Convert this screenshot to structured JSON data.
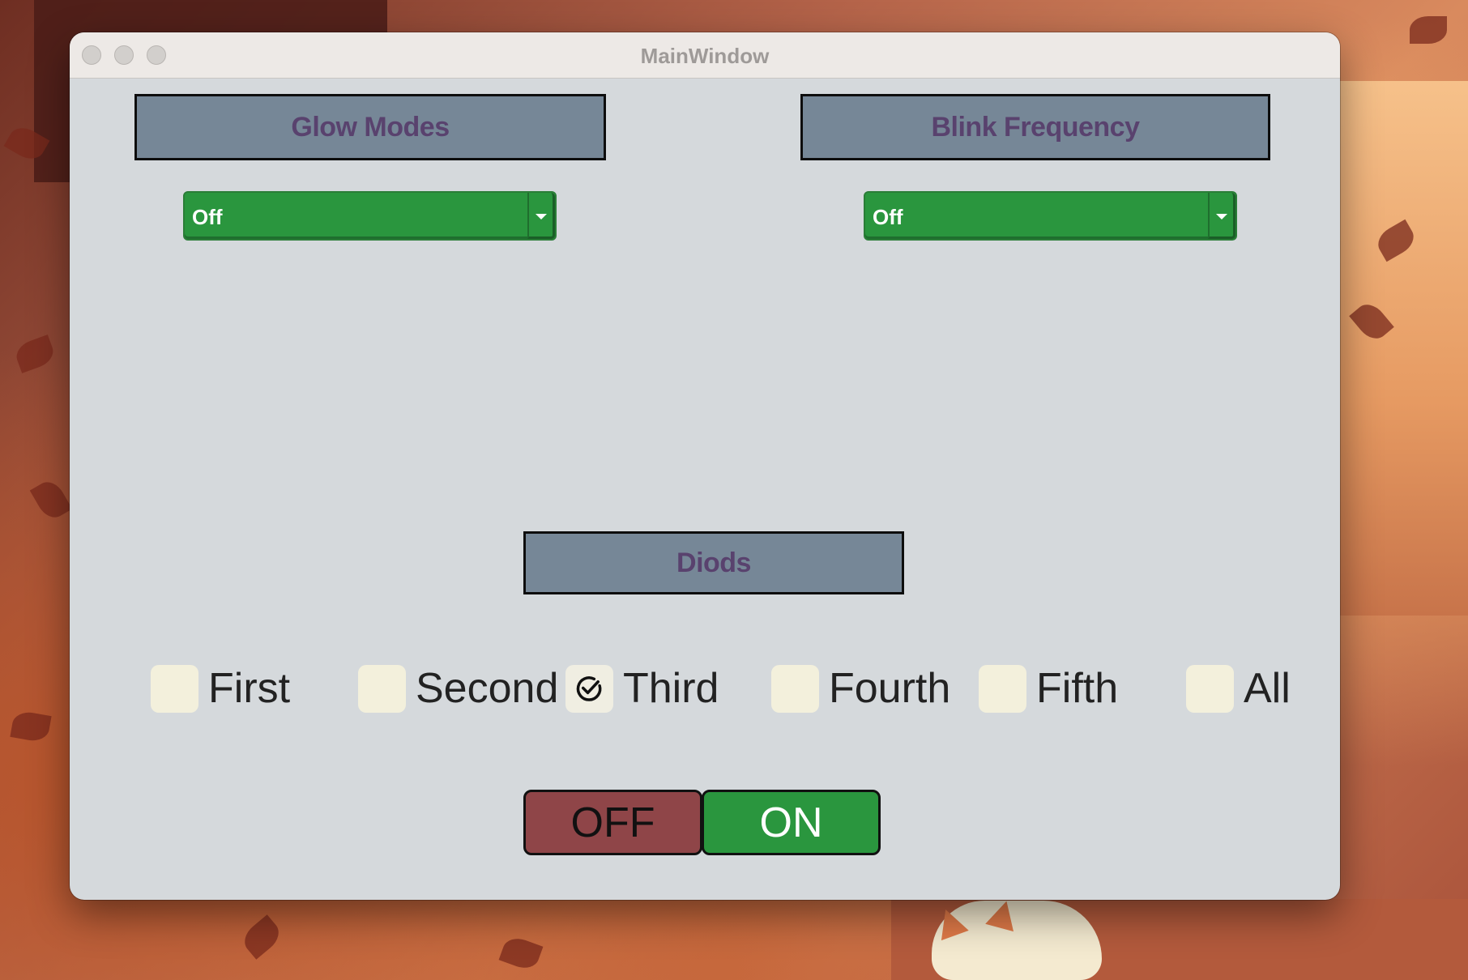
{
  "window": {
    "title": "MainWindow"
  },
  "glow_modes": {
    "header": "Glow Modes",
    "selected": "Off"
  },
  "blink_frequency": {
    "header": "Blink Frequency",
    "selected": "Off"
  },
  "diods": {
    "header": "Diods",
    "items": [
      {
        "label": "First",
        "checked": false
      },
      {
        "label": "Second",
        "checked": false
      },
      {
        "label": "Third",
        "checked": true
      },
      {
        "label": "Fourth",
        "checked": false
      },
      {
        "label": "Fifth",
        "checked": false
      },
      {
        "label": "All",
        "checked": false
      }
    ]
  },
  "power": {
    "off_label": "OFF",
    "on_label": "ON"
  },
  "colors": {
    "header_bg": "#768797",
    "header_text": "#59426e",
    "combo_bg": "#2a963e",
    "off_button": "#8f4548",
    "on_button": "#2a963e",
    "window_bg": "#d5d9dc"
  },
  "icons": {
    "combo_arrow": "chevron-down-icon",
    "check_mark": "check-circle-icon"
  }
}
